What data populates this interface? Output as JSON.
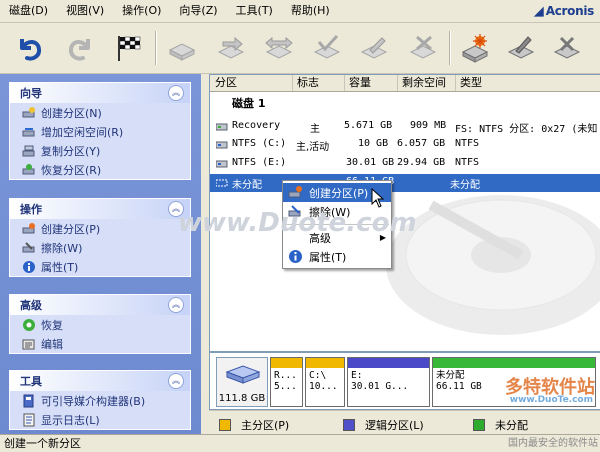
{
  "menu": [
    "磁盘(D)",
    "视图(V)",
    "操作(O)",
    "向导(Z)",
    "工具(T)",
    "帮助(H)"
  ],
  "brand": {
    "name": "Acronis"
  },
  "toolbar": {
    "icons": [
      "undo-icon",
      "redo-icon",
      "commit-flag-icon",
      "create-partition-icon",
      "move-partition-icon",
      "resize-partition-icon",
      "format-icon",
      "copy-partition-icon",
      "delete-partition-icon",
      "wizard-icon",
      "properties-icon",
      "more-icon"
    ]
  },
  "sidebar": {
    "wizard": {
      "title": "向导",
      "items": [
        "创建分区(N)",
        "增加空闲空间(R)",
        "复制分区(Y)",
        "恢复分区(R)"
      ]
    },
    "operations": {
      "title": "操作",
      "items": [
        "创建分区(P)",
        "擦除(W)",
        "属性(T)"
      ]
    },
    "advanced": {
      "title": "高级",
      "items": [
        "恢复",
        "编辑"
      ]
    },
    "tools": {
      "title": "工具",
      "items": [
        "可引导媒介构建器(B)",
        "显示日志(L)"
      ]
    }
  },
  "columns": [
    "分区",
    "标志",
    "容量",
    "剩余空间",
    "类型"
  ],
  "disk_label": "磁盘 1",
  "rows": [
    {
      "name": "Recovery",
      "flag": "主",
      "size": "5.671 GB",
      "free": "909 MB",
      "type": "FS: NTFS 分区: 0x27 (未知"
    },
    {
      "name": "NTFS (C:)",
      "flag": "主,活动",
      "size": "10 GB",
      "free": "6.057 GB",
      "type": "NTFS"
    },
    {
      "name": "NTFS (E:)",
      "flag": "",
      "size": "30.01 GB",
      "free": "29.94 GB",
      "type": "NTFS"
    },
    {
      "name": "未分配",
      "flag": "",
      "size": "66.11 GB",
      "free": "",
      "type": "未分配"
    }
  ],
  "context_menu": {
    "items": [
      "创建分区(P)",
      "擦除(W)",
      "高级",
      "属性(T)"
    ]
  },
  "disk_map": {
    "disk_size": "111.8 GB",
    "parts": [
      {
        "line1": "R...",
        "line2": "5...",
        "color": "#f0b800"
      },
      {
        "line1": "C:\\",
        "line2": "10...",
        "color": "#f0b800"
      },
      {
        "line1": "E:",
        "line2": "30.01 G...",
        "color": "#4a4ac8"
      },
      {
        "line1": "未分配",
        "line2": "66.11 GB",
        "color": "#38b838"
      }
    ]
  },
  "legend": [
    {
      "label": "主分区(P)",
      "color": "#f0b800"
    },
    {
      "label": "逻辑分区(L)",
      "color": "#5050c8"
    },
    {
      "label": "未分配",
      "color": "#2eaa2e"
    }
  ],
  "status": "创建一个新分区",
  "watermarks": {
    "center": "www.Duote.com",
    "corner": "多特软件站",
    "corner_url": "www.DuoTe.com",
    "corner_sub": "国内最安全的软件站"
  }
}
